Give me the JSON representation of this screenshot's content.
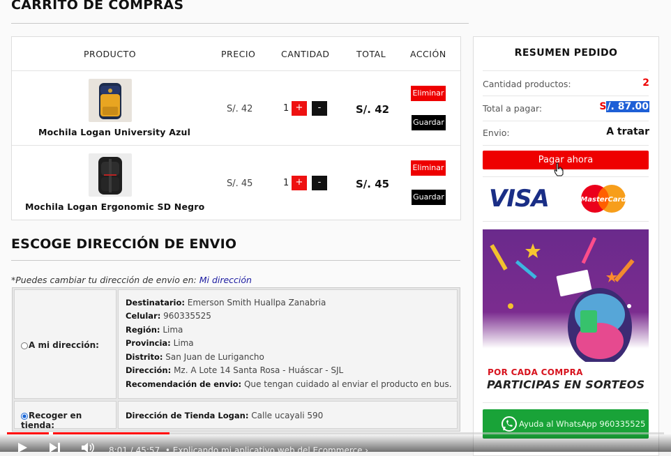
{
  "page": {
    "title": "CARRITO DE COMPRAS"
  },
  "cart": {
    "headers": [
      "PRODUCTO",
      "PRECIO",
      "CANTIDAD",
      "TOTAL",
      "ACCIÓN"
    ],
    "items": [
      {
        "name": "Mochila Logan University Azul",
        "price": "S/. 42",
        "qty": "1",
        "total": "S/. 42",
        "plus": "+",
        "minus": "-",
        "delete": "Eliminar",
        "save": "Guardar"
      },
      {
        "name": "Mochila Logan Ergonomic SD Negro",
        "price": "S/. 45",
        "qty": "1",
        "total": "S/. 45",
        "plus": "+",
        "minus": "-",
        "delete": "Eliminar",
        "save": "Guardar"
      }
    ]
  },
  "shipping": {
    "title": "ESCOGE DIRECCIÓN DE ENVIO",
    "note": "*Puedes cambiar tu dirección de envio en:",
    "note_link": "Mi dirección",
    "option_home": "A mi dirección:",
    "option_store": "Recoger en tienda:",
    "home_selected": false,
    "store_selected": true,
    "address": [
      {
        "label": "Destinatario:",
        "value": "Emerson Smith Huallpa Zanabria"
      },
      {
        "label": "Celular:",
        "value": "960335525"
      },
      {
        "label": "Región:",
        "value": "Lima"
      },
      {
        "label": "Provincia:",
        "value": "Lima"
      },
      {
        "label": "Distrito:",
        "value": "San Juan de Lurigancho"
      },
      {
        "label": "Dirección:",
        "value": "Mz. A Lote 14 Santa Rosa - Huáscar - SJL"
      },
      {
        "label": "Recomendación de envio:",
        "value": "Que tengan cuidado al enviar el producto en bus."
      }
    ],
    "store_address_label": "Dirección de Tienda Logan:",
    "store_address_value": "Calle ucayali 590"
  },
  "summary": {
    "title": "RESUMEN PEDIDO",
    "qty_label": "Cantidad productos:",
    "qty_value": "2",
    "total_label": "Total a pagar:",
    "total_value_s": "S",
    "total_value_rest": "/. 87.00",
    "shipping_label": "Envio:",
    "shipping_value": "A tratar",
    "pay_button": "Pagar ahora",
    "visa_text": "VISA",
    "mastercard_text": "MasterCard",
    "promo_line1": "POR CADA COMPRA",
    "promo_line2": "PARTICIPAS EN SORTEOS",
    "whatsapp_button": "Ayuda al WhatsApp 960335525",
    "colors": {
      "accent_red": "#ee0000",
      "whatsapp_green": "#19a338",
      "promo_purple": "#6a2a8c"
    }
  },
  "video": {
    "time": "8:01 / 45:57",
    "chapter": "• Explicando mi aplicativo web del Ecommerce",
    "played_fraction": 0.247
  }
}
